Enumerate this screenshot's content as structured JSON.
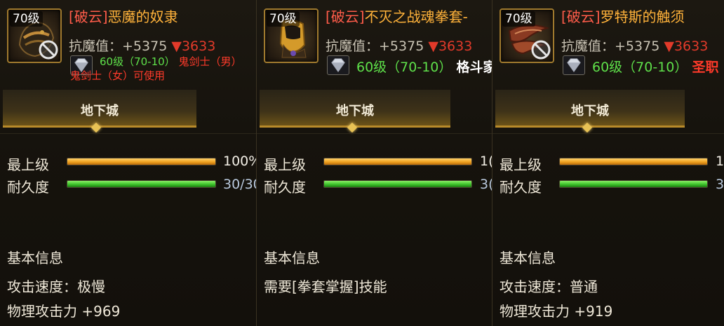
{
  "panels": [
    {
      "level_tag": "70级",
      "art": "demon-slave-mask-icon",
      "title_prefix": "[破云]",
      "title_name": "恶魔的奴隶",
      "resist_label": "抗魔值：",
      "resist_value": "+5375",
      "resist_down_arrow": "▼",
      "resist_down": "3633",
      "req_level": "60级（70-10）",
      "req_class_line1": "鬼剑士（男）",
      "req_class_line2": "鬼剑士（女）可使用",
      "tab_label": "地下城",
      "bar1_label": "最上级",
      "bar1_fraction": 1.0,
      "bar1_value": "100%",
      "bar2_label": "耐久度",
      "bar2_fraction": 1.0,
      "bar2_value": "30/30",
      "section_title": "基本信息",
      "info1": "攻击速度：极慢",
      "info2": "物理攻击力 +969"
    },
    {
      "level_tag": "70级",
      "art": "golden-gauntlet-icon",
      "title_prefix": "[破云]",
      "title_name": "不灭之战魂拳套-",
      "resist_label": "抗魔值：",
      "resist_value": "+5375",
      "resist_down_arrow": "▼",
      "resist_down": "3633",
      "req_level": "60级（70-10）",
      "req_class_line1": "格斗家",
      "tab_label": "地下城",
      "bar1_label": "最上级",
      "bar1_fraction": 1.0,
      "bar1_value": "1(",
      "bar2_label": "耐久度",
      "bar2_fraction": 1.0,
      "bar2_value": "3(",
      "section_title": "基本信息",
      "info1": "需要[拳套掌握]技能"
    },
    {
      "level_tag": "70级",
      "art": "tentacle-weapon-icon",
      "title_prefix": "[破云]",
      "title_name": "罗特斯的触须",
      "resist_label": "抗魔值：",
      "resist_value": "+5375",
      "resist_down_arrow": "▼",
      "resist_down": "3633",
      "req_level": "60级（70-10）",
      "req_class_line1": "圣职",
      "tab_label": "地下城",
      "bar1_label": "最上级",
      "bar1_fraction": 1.0,
      "bar1_value": "1(",
      "bar2_label": "耐久度",
      "bar2_fraction": 1.0,
      "bar2_value": "3(",
      "section_title": "基本信息",
      "info1": "攻击速度：普通",
      "info2": "物理攻击力 +919"
    }
  ]
}
